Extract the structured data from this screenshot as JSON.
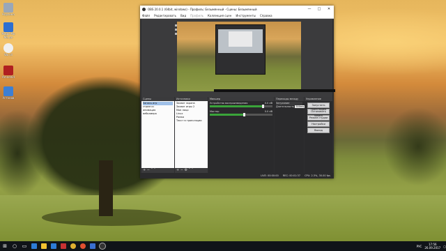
{
  "desktop": {
    "icons": [
      {
        "label": "Корзина",
        "icon": "recycle-bin-icon",
        "color": "#9aa7b8"
      },
      {
        "label": "Magic Mo Ma до",
        "icon": "app-icon",
        "color": "#2d6fd1"
      },
      {
        "label": "Wo cli",
        "icon": "app-icon",
        "color": "#f0f0f0"
      },
      {
        "label": "AmneVid",
        "icon": "app-icon",
        "color": "#b02020"
      },
      {
        "label": "Установ",
        "icon": "app-icon",
        "color": "#3c7fd4"
      }
    ]
  },
  "window": {
    "title": "OBS 20.0.1 (64bit, windows) - Профиль: Безымянный - Сцены: Безымянный",
    "controls": {
      "minimize": "—",
      "maximize": "□",
      "close": "✕"
    },
    "menu": [
      "Файл",
      "Редактировать",
      "Вид",
      "Профиль",
      "Коллекция сцен",
      "Инструменты",
      "Справка"
    ]
  },
  "docks": {
    "scenes": {
      "title": "Сцены",
      "items": [
        "Запись игр",
        "стрим кс",
        "анимация",
        "вебкамера"
      ],
      "selected": 0
    },
    "sources": {
      "title": "Источники",
      "items": [
        "Захват экрана",
        "Захват игры 2",
        "Мое лицо",
        "Linux",
        "Рамка",
        "Текст в трансляции"
      ]
    },
    "mixer": {
      "title": "Микшер",
      "channels": [
        {
          "name": "Устройство воспроизведения",
          "db": "0.0 dB",
          "level": 0.85
        },
        {
          "name": "Мастер",
          "db": "0.0 dB",
          "level": 0.55
        }
      ]
    },
    "transitions": {
      "title": "Переходы между сценами",
      "type": "Затухание",
      "duration_label": "Длительность",
      "duration": "300ms"
    },
    "controls": {
      "title": "Управление",
      "buttons": [
        "Запустить трансляцию",
        "Остановить запись",
        "Режим студии",
        "Настройки",
        "Выход"
      ]
    }
  },
  "status": {
    "live": "LIVE: 00:00:00",
    "rec": "REC: 00:01:37",
    "cpu": "CPU: 2.3%, 30.00 fps"
  },
  "taskbar": {
    "apps": [
      {
        "name": "start-icon",
        "color": "#ffffff"
      },
      {
        "name": "search-icon",
        "color": "#ffffff"
      },
      {
        "name": "task-view-icon",
        "color": "#ffffff"
      },
      {
        "name": "edge-icon",
        "color": "#2d7cd6"
      },
      {
        "name": "explorer-icon",
        "color": "#f2c231"
      },
      {
        "name": "store-icon",
        "color": "#2d7cd6"
      },
      {
        "name": "app-icon",
        "color": "#c83232"
      },
      {
        "name": "chrome-icon",
        "color": "#e0b030"
      },
      {
        "name": "app-icon",
        "color": "#e05030"
      },
      {
        "name": "app-icon",
        "color": "#3a6fd0"
      },
      {
        "name": "obs-icon",
        "color": "#333333"
      }
    ],
    "lang": "РУС",
    "time": "17:56",
    "date": "26.09.2017"
  }
}
